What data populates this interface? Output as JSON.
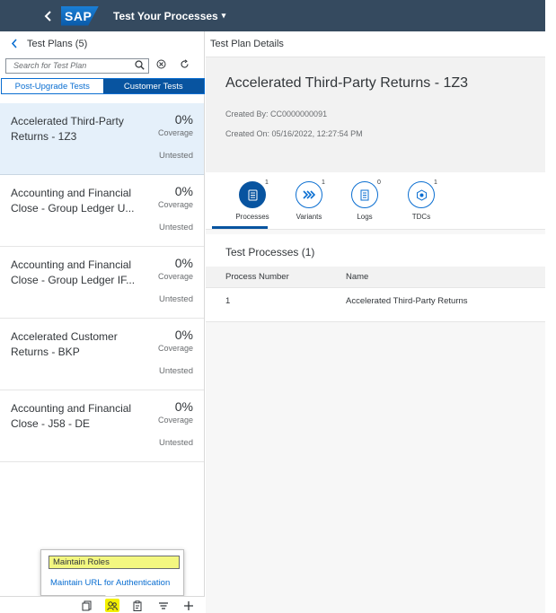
{
  "shell": {
    "back_icon": "chevron-left-icon",
    "logo": "SAP",
    "title": "Test Your Processes",
    "title_caret": "▾"
  },
  "master": {
    "header": "Test Plans (5)",
    "search_placeholder": "Search for Test Plan",
    "segments": [
      "Post-Upgrade Tests",
      "Customer Tests"
    ],
    "active_segment": "Customer Tests",
    "items": [
      {
        "name": "Accelerated Third-Party Returns - 1Z3",
        "coverage": "0%",
        "coverage_label": "Coverage",
        "status": "Untested",
        "selected": true
      },
      {
        "name": "Accounting and Financial Close - Group Ledger U...",
        "coverage": "0%",
        "coverage_label": "Coverage",
        "status": "Untested",
        "selected": false
      },
      {
        "name": "Accounting and Financial Close - Group Ledger IF...",
        "coverage": "0%",
        "coverage_label": "Coverage",
        "status": "Untested",
        "selected": false
      },
      {
        "name": "Accelerated Customer Returns - BKP",
        "coverage": "0%",
        "coverage_label": "Coverage",
        "status": "Untested",
        "selected": false
      },
      {
        "name": "Accounting and Financial Close - J58 - DE",
        "coverage": "0%",
        "coverage_label": "Coverage",
        "status": "Untested",
        "selected": false
      }
    ]
  },
  "popup": {
    "items": [
      "Maintain Roles",
      "Maintain URL for Authentication"
    ]
  },
  "footer": {
    "icons": [
      "copy-icon",
      "roles-icon",
      "clipboard-icon",
      "sort-icon",
      "add-icon"
    ]
  },
  "detail": {
    "bar_title": "Test Plan Details",
    "title": "Accelerated Third-Party Returns - 1Z3",
    "created_by": "Created By: CC0000000091",
    "created_on": "Created On: 05/16/2022, 12:27:54 PM",
    "tabs": [
      {
        "label": "Processes",
        "count": "1",
        "icon": "list-icon",
        "active": true
      },
      {
        "label": "Variants",
        "count": "1",
        "icon": "chevrons-right-icon",
        "active": false
      },
      {
        "label": "Logs",
        "count": "0",
        "icon": "document-icon",
        "active": false
      },
      {
        "label": "TDCs",
        "count": "1",
        "icon": "cube-icon",
        "active": false
      }
    ],
    "processes": {
      "title": "Test Processes (1)",
      "columns": [
        "Process Number",
        "Name"
      ],
      "rows": [
        {
          "number": "1",
          "name": "Accelerated Third-Party Returns"
        }
      ]
    }
  },
  "colors": {
    "shell": "#354a5f",
    "accent": "#0a6ed1",
    "selected_row": "#e5f0fa",
    "highlight": "#f3f780"
  }
}
